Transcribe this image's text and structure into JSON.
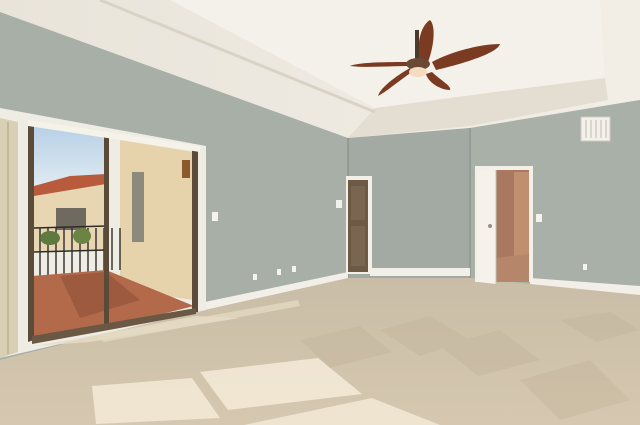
{
  "scene": {
    "description_label": "",
    "colors": {
      "wall": "#a9b1a8",
      "wall_light": "#b7bdb3",
      "ceiling": "#ece8e0",
      "tray_ceiling": "#f3efe7",
      "carpet": "#cdbfa8",
      "trim": "#f4f2ec",
      "fan_wood": "#7a3a22",
      "door": "#f1efe9",
      "balcony_floor": "#b56b4c",
      "exterior_wall": "#e8d4ae",
      "sky": "#c9dcec",
      "sunlight": "#f7efdc"
    },
    "objects": [
      "ceiling-fan",
      "sliding-glass-door",
      "balcony",
      "interior-door-open",
      "interior-door-closed",
      "air-vent",
      "carpet-floor",
      "tray-ceiling"
    ]
  }
}
